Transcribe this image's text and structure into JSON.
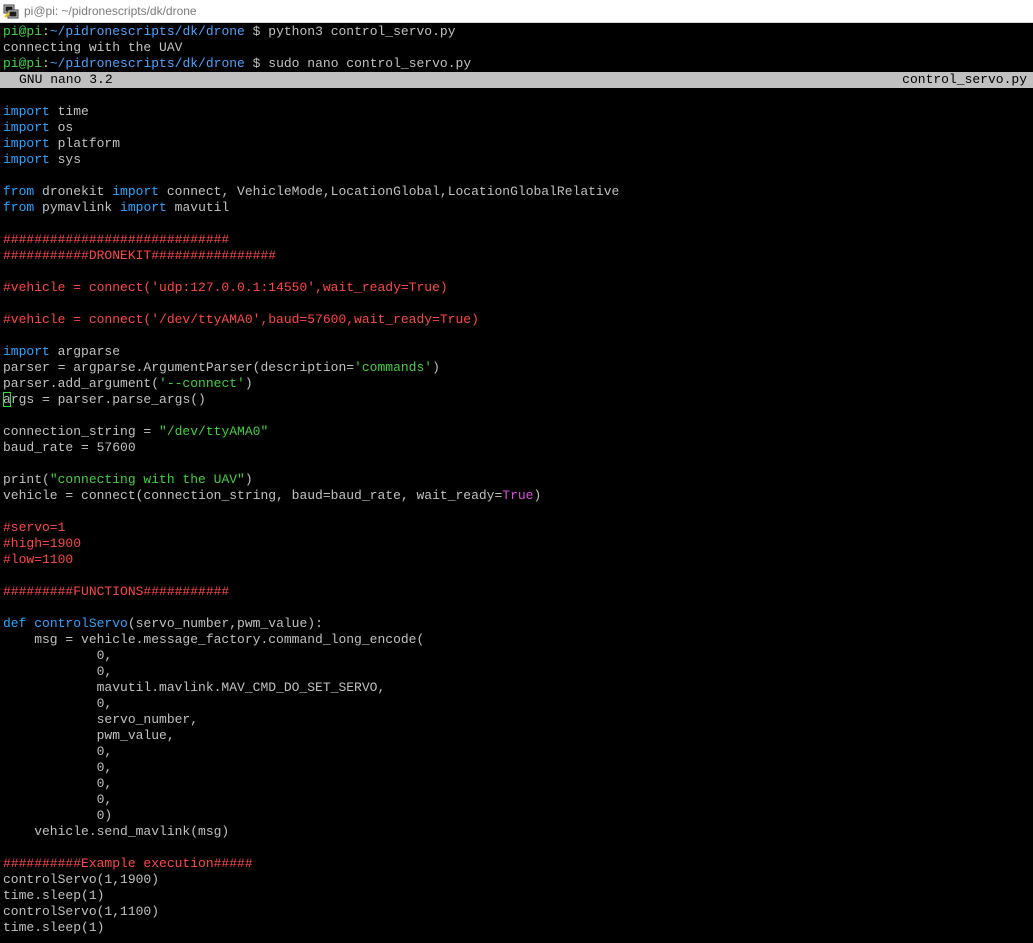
{
  "window": {
    "title": "pi@pi: ~/pidronescripts/dk/drone",
    "icon": "putty-terminal-icon"
  },
  "shell": [
    {
      "user": "pi@pi",
      "sep": ":",
      "path": "~/pidronescripts/dk/drone",
      "prompt": " $ ",
      "cmd": "python3 control_servo.py"
    },
    {
      "output": "connecting with the UAV"
    },
    {
      "user": "pi@pi",
      "sep": ":",
      "path": "~/pidronescripts/dk/drone",
      "prompt": " $ ",
      "cmd": "sudo nano control_servo.py"
    }
  ],
  "nano": {
    "version": "GNU nano 3.2",
    "filename": "control_servo.py"
  },
  "colors": {
    "keyword": "#2aa6ff",
    "comment": "#ff4646",
    "string": "#3fd13f",
    "builtin": "#d74fd7",
    "text": "#c0c0c0",
    "prompt_user": "#44d844",
    "prompt_path": "#4aa3ff",
    "cursor": "#2de02d"
  },
  "code": [
    [],
    [
      {
        "t": "import",
        "k": "kw"
      },
      {
        "t": " time"
      }
    ],
    [
      {
        "t": "import",
        "k": "kw"
      },
      {
        "t": " os"
      }
    ],
    [
      {
        "t": "import",
        "k": "kw"
      },
      {
        "t": " platform"
      }
    ],
    [
      {
        "t": "import",
        "k": "kw"
      },
      {
        "t": " sys"
      }
    ],
    [],
    [
      {
        "t": "from",
        "k": "kw"
      },
      {
        "t": " dronekit "
      },
      {
        "t": "import",
        "k": "kw"
      },
      {
        "t": " connect, VehicleMode,LocationGlobal,LocationGlobalRelative"
      }
    ],
    [
      {
        "t": "from",
        "k": "kw"
      },
      {
        "t": " pymavlink "
      },
      {
        "t": "import",
        "k": "kw"
      },
      {
        "t": " mavutil"
      }
    ],
    [],
    [
      {
        "t": "#############################",
        "k": "cmt"
      }
    ],
    [
      {
        "t": "###########DRONEKIT################",
        "k": "cmt"
      }
    ],
    [],
    [
      {
        "t": "#vehicle = connect('udp:127.0.0.1:14550',wait_ready=True)",
        "k": "cmt"
      }
    ],
    [],
    [
      {
        "t": "#vehicle = connect('/dev/ttyAMA0',baud=57600,wait_ready=True)",
        "k": "cmt"
      }
    ],
    [],
    [
      {
        "t": "import",
        "k": "kw"
      },
      {
        "t": " argparse"
      }
    ],
    [
      {
        "t": "parser = argparse.ArgumentParser(description="
      },
      {
        "t": "'commands'",
        "k": "str"
      },
      {
        "t": ")"
      }
    ],
    [
      {
        "t": "parser.add_argument("
      },
      {
        "t": "'--connect'",
        "k": "str"
      },
      {
        "t": ")"
      }
    ],
    [
      {
        "t": "a",
        "k": "cursor"
      },
      {
        "t": "rgs = parser.parse_args()"
      }
    ],
    [],
    [
      {
        "t": "connection_string = "
      },
      {
        "t": "\"/dev/ttyAMA0\"",
        "k": "str"
      }
    ],
    [
      {
        "t": "baud_rate = 57600"
      }
    ],
    [],
    [
      {
        "t": "print("
      },
      {
        "t": "\"connecting with the UAV\"",
        "k": "str"
      },
      {
        "t": ")"
      }
    ],
    [
      {
        "t": "vehicle = connect(connection_string, baud=baud_rate, wait_ready="
      },
      {
        "t": "True",
        "k": "magenta"
      },
      {
        "t": ")"
      }
    ],
    [],
    [
      {
        "t": "#servo=1",
        "k": "cmt"
      }
    ],
    [
      {
        "t": "#high=1900",
        "k": "cmt"
      }
    ],
    [
      {
        "t": "#low=1100",
        "k": "cmt"
      }
    ],
    [],
    [
      {
        "t": "#########FUNCTIONS###########",
        "k": "cmt"
      }
    ],
    [],
    [
      {
        "t": "def",
        "k": "kw"
      },
      {
        "t": " "
      },
      {
        "t": "controlServo",
        "k": "kw"
      },
      {
        "t": "(servo_number,pwm_value):"
      }
    ],
    [
      {
        "t": "    msg = vehicle.message_factory.command_long_encode("
      }
    ],
    [
      {
        "t": "            0,"
      }
    ],
    [
      {
        "t": "            0,"
      }
    ],
    [
      {
        "t": "            mavutil.mavlink.MAV_CMD_DO_SET_SERVO,"
      }
    ],
    [
      {
        "t": "            0,"
      }
    ],
    [
      {
        "t": "            servo_number,"
      }
    ],
    [
      {
        "t": "            pwm_value,"
      }
    ],
    [
      {
        "t": "            0,"
      }
    ],
    [
      {
        "t": "            0,"
      }
    ],
    [
      {
        "t": "            0,"
      }
    ],
    [
      {
        "t": "            0,"
      }
    ],
    [
      {
        "t": "            0)"
      }
    ],
    [
      {
        "t": "    vehicle.send_mavlink(msg)"
      }
    ],
    [],
    [
      {
        "t": "##########Example execution#####",
        "k": "cmt"
      }
    ],
    [
      {
        "t": "controlServo(1,1900)"
      }
    ],
    [
      {
        "t": "time.sleep(1)"
      }
    ],
    [
      {
        "t": "controlServo(1,1100)"
      }
    ],
    [
      {
        "t": "time.sleep(1)"
      }
    ]
  ]
}
